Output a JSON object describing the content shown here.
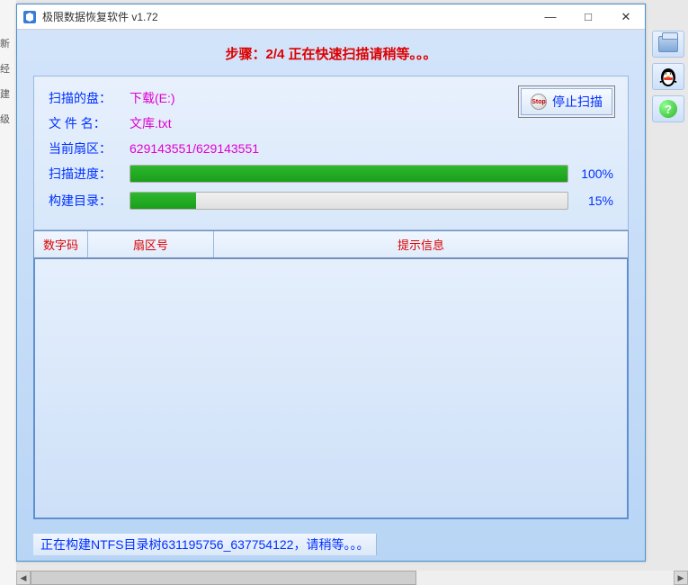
{
  "left_strip": {
    "items": [
      "新",
      "经",
      "建",
      "级"
    ]
  },
  "window": {
    "title": "极限数据恢复软件 v1.72",
    "controls": {
      "minimize": "—",
      "maximize": "□",
      "close": "✕"
    }
  },
  "step_header": "步骤：2/4 正在快速扫描请稍等。。。",
  "scan": {
    "disk_label": "扫描的盘：",
    "disk_value": "下载(E:)",
    "file_label": "文 件 名：",
    "file_value": "文库.txt",
    "sector_label": "当前扇区：",
    "sector_value": "629143551/629143551",
    "scan_prog_label": "扫描进度：",
    "scan_prog_pct": "100%",
    "scan_prog_fill": 100,
    "build_prog_label": "构建目录：",
    "build_prog_pct": "15%",
    "build_prog_fill": 15,
    "stop_label": "停止扫描",
    "stop_icon_text": "Stop"
  },
  "table": {
    "headers": {
      "col1": "数字码",
      "col2": "扇区号",
      "col3": "提示信息"
    }
  },
  "statusbar": "正在构建NTFS目录树631195756_637754122，请稍等。。。",
  "side": {
    "help_char": "?"
  }
}
